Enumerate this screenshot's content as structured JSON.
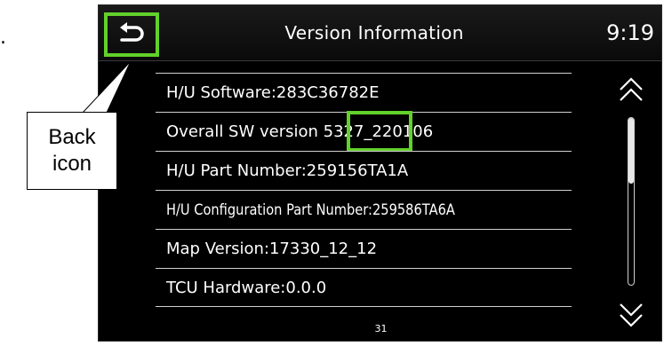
{
  "stray_mark": ".",
  "header": {
    "title": "Version Information",
    "time": "9:19"
  },
  "back_button": {
    "icon": "back-arrow-icon"
  },
  "version_items": [
    {
      "label": "H/U Software:283C36782E"
    },
    {
      "label": "Overall SW version 5327_220106"
    },
    {
      "label": "H/U Part Number:259156TA1A"
    },
    {
      "label": "H/U Configuration Part Number:259586TA6A"
    },
    {
      "label": "Map Version:17330_12_12"
    },
    {
      "label": "TCU Hardware:0.0.0"
    }
  ],
  "scroll": {
    "up_icon": "double-chevron-up-icon",
    "down_icon": "double-chevron-down-icon"
  },
  "page_number": "31",
  "annotation": {
    "callout_line1": "Back",
    "callout_line2": "icon"
  },
  "colors": {
    "highlight": "#62d12a",
    "screen_background": "#000000",
    "text": "#ffffff"
  }
}
